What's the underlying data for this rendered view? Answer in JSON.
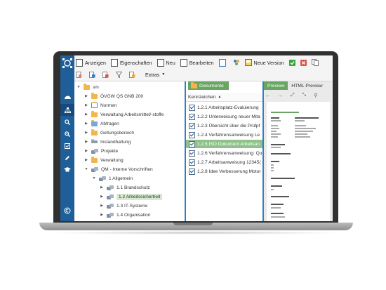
{
  "toolbar": {
    "anzeigen": "Anzeigen",
    "eigenschaften": "Eigenschaften",
    "neu": "Neu",
    "bearbeiten": "Bearbeiten",
    "neue_version": "Neue Version",
    "extras": "Extras"
  },
  "tree": {
    "root": "sm",
    "items": [
      "ÖVGW QS GNB 200",
      "Normen",
      "Verwaltung Arbeitsmittel/-stoffe",
      "Abfragen",
      "Geltungsbereich",
      "Instandhaltung",
      "Projekte",
      "Verwaltung",
      "QM - Interne Vorschriften",
      "1 Allgemein",
      "1.1 Brandschutz",
      "1.2 Arbeitssicherheit",
      "1.3 IT-Systeme",
      "1.4 Organisation"
    ]
  },
  "list": {
    "tab": "Dokumente",
    "column": "Kennzeichen",
    "sort_indicator": "▲",
    "rows": [
      "1.2.1 Arbeitsplatz-Evaluierung",
      "1.2.2 Unterweisung neuer Mita",
      "1.2.3 Übersicht über die Prüfpf",
      "1.2.4 Verfahrensanweisung Le",
      "1.2.5 ISO Dokument Arbeitsan",
      "1.2.6 Verfahrensanweisung: Qu",
      "1.2.7 Arbeitsanweisung 12345(",
      "1.2.8 Idee Verbesserung Motor"
    ]
  },
  "preview": {
    "tabs": [
      "Preview",
      "HTML Preview"
    ]
  },
  "colors": {
    "rail": "#1f5f99",
    "accent_green": "#6aa663",
    "selection_green": "#8fc28a",
    "panel_divider": "#2f7ec7"
  }
}
